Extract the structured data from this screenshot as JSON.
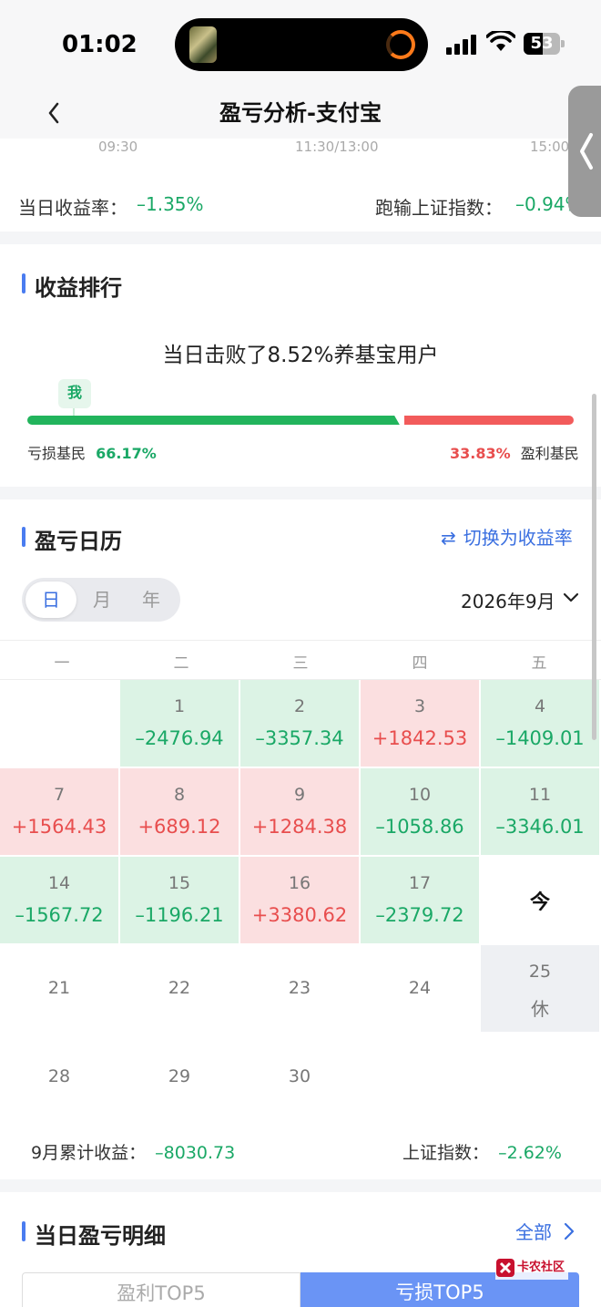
{
  "status_bar": {
    "time": "01:02",
    "battery": "53",
    "battery_level": 0.53
  },
  "nav": {
    "title": "盈亏分析-支付宝"
  },
  "intraday": {
    "times": [
      "09:30",
      "11:30/13:00",
      "15:00"
    ],
    "daily_return_label": "当日收益率：",
    "daily_return_value": "–1.35%",
    "index_label": "跑输上证指数：",
    "index_value": "–0.94%"
  },
  "ranking": {
    "title": "收益排行",
    "summary": "当日击败了8.52%养基宝用户",
    "me_tag": "我",
    "me_position": 0.085,
    "loss_share": 0.6617,
    "loss_label": "亏损基民",
    "loss_value": "66.17%",
    "profit_label": "盈利基民",
    "profit_value": "33.83%",
    "colors": {
      "loss": "#22b45c",
      "profit": "#f25b5b"
    }
  },
  "calendar": {
    "title": "盈亏日历",
    "switch_label": "切换为收益率",
    "segments": [
      "日",
      "月",
      "年"
    ],
    "active_segment": 0,
    "month": "2026年9月",
    "weekdays": [
      "一",
      "二",
      "三",
      "四",
      "五"
    ],
    "rows": [
      [
        null,
        {
          "day": "1",
          "value": "–2476.94",
          "tone": "g"
        },
        {
          "day": "2",
          "value": "–3357.34",
          "tone": "g"
        },
        {
          "day": "3",
          "value": "+1842.53",
          "tone": "r"
        },
        {
          "day": "4",
          "value": "–1409.01",
          "tone": "g"
        }
      ],
      [
        {
          "day": "7",
          "value": "+1564.43",
          "tone": "r"
        },
        {
          "day": "8",
          "value": "+689.12",
          "tone": "r"
        },
        {
          "day": "9",
          "value": "+1284.38",
          "tone": "r"
        },
        {
          "day": "10",
          "value": "–1058.86",
          "tone": "g"
        },
        {
          "day": "11",
          "value": "–3346.01",
          "tone": "g"
        }
      ],
      [
        {
          "day": "14",
          "value": "–1567.72",
          "tone": "g"
        },
        {
          "day": "15",
          "value": "–1196.21",
          "tone": "g"
        },
        {
          "day": "16",
          "value": "+3380.62",
          "tone": "r"
        },
        {
          "day": "17",
          "value": "–2379.72",
          "tone": "g"
        },
        {
          "today": "今"
        }
      ],
      [
        {
          "day": "21"
        },
        {
          "day": "22"
        },
        {
          "day": "23"
        },
        {
          "day": "24"
        },
        {
          "day": "25",
          "rest": "休",
          "tone": "h"
        }
      ],
      [
        {
          "day": "28"
        },
        {
          "day": "29"
        },
        {
          "day": "30"
        },
        null,
        null
      ]
    ],
    "month_total_label": "9月累计收益：",
    "month_total_value": "–8030.73",
    "month_index_label": "上证指数：",
    "month_index_value": "–2.62%"
  },
  "detail": {
    "title": "当日盈亏明细",
    "all_label": "全部",
    "tab_profit": "盈利TOP5",
    "tab_loss": "亏损TOP5",
    "watermark": "卡农社区"
  }
}
